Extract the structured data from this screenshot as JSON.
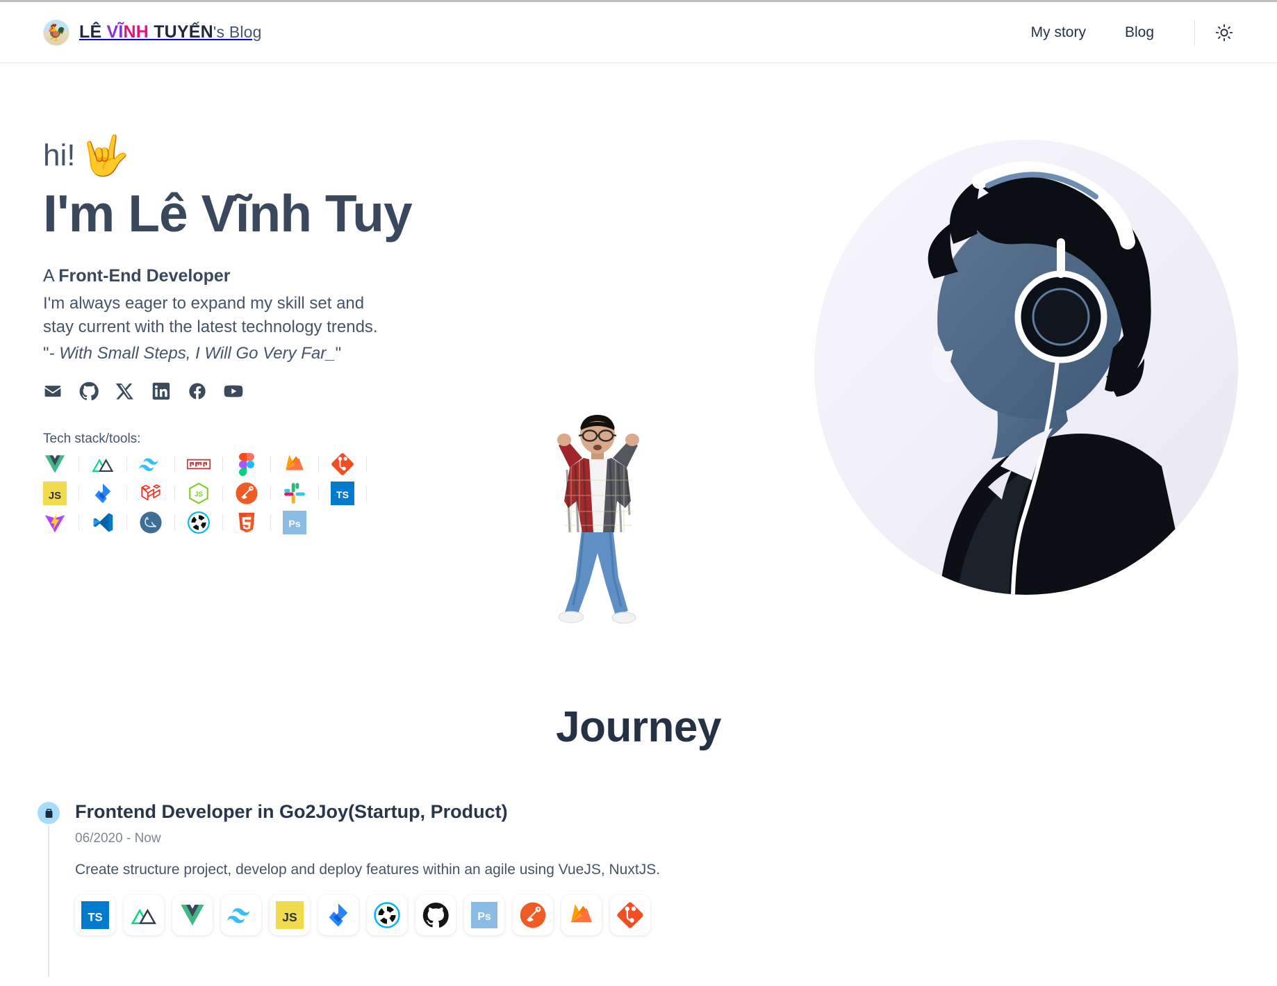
{
  "header": {
    "brand": {
      "avatar_icon": "rooster-avatar",
      "part1": "LÊ ",
      "part2": "VĨ",
      "part3": "N",
      "part4": "H",
      "part5": " TUYẾN",
      "suffix": "'s Blog"
    },
    "nav": [
      {
        "label": "My story",
        "name": "nav-my-story"
      },
      {
        "label": "Blog",
        "name": "nav-blog"
      }
    ],
    "theme_toggle_icon": "sun-icon"
  },
  "hero": {
    "greeting": "hi!",
    "greeting_emoji": "🤟",
    "name_line": "I'm Lê Vĩnh Tuy",
    "role_prefix": "A ",
    "role": "Front-End Developer",
    "blurb_line1": "I'm always eager to expand my skill set and",
    "blurb_line2": "stay current with the latest technology trends.",
    "quote_open": "\"",
    "quote_text": "- With Small Steps, I Will Go Very Far_",
    "quote_close": "\"",
    "socials": [
      {
        "name": "email-icon",
        "label": "Email"
      },
      {
        "name": "github-icon",
        "label": "GitHub"
      },
      {
        "name": "x-twitter-icon",
        "label": "X"
      },
      {
        "name": "linkedin-icon",
        "label": "LinkedIn"
      },
      {
        "name": "facebook-icon",
        "label": "Facebook"
      },
      {
        "name": "youtube-icon",
        "label": "YouTube"
      }
    ],
    "tech_label": "Tech stack/tools:",
    "tech_rows": [
      [
        {
          "name": "vue-icon",
          "label": "Vue.js"
        },
        {
          "name": "nuxt-icon",
          "label": "Nuxt"
        },
        {
          "name": "tailwind-icon",
          "label": "Tailwind CSS"
        },
        {
          "name": "npm-icon",
          "label": "npm"
        },
        {
          "name": "figma-icon",
          "label": "Figma"
        },
        {
          "name": "firebase-icon",
          "label": "Firebase"
        },
        {
          "name": "sourcetree-icon",
          "label": "Sourcetree"
        }
      ],
      [
        {
          "name": "javascript-icon",
          "label": "JavaScript"
        },
        {
          "name": "jira-icon",
          "label": "Jira"
        },
        {
          "name": "laravel-icon",
          "label": "Laravel"
        },
        {
          "name": "nodejs-icon",
          "label": "Node.js"
        },
        {
          "name": "postman-icon",
          "label": "Postman"
        },
        {
          "name": "slack-icon",
          "label": "Slack"
        },
        {
          "name": "typescript-icon",
          "label": "TypeScript"
        }
      ],
      [
        {
          "name": "vite-icon",
          "label": "Vite"
        },
        {
          "name": "vscode-icon",
          "label": "VS Code"
        },
        {
          "name": "dbeaver-icon",
          "label": "DBeaver"
        },
        {
          "name": "quasar-icon",
          "label": "Quasar"
        },
        {
          "name": "html5-icon",
          "label": "HTML5"
        },
        {
          "name": "photoshop-icon",
          "label": "Photoshop"
        }
      ]
    ],
    "dancer_alt": "dancing-avatar-character",
    "portrait_alt": "headphones-profile-illustration"
  },
  "journey": {
    "title": "Journey",
    "items": [
      {
        "icon": "briefcase-icon",
        "title": "Frontend Developer in Go2Joy(Startup, Product)",
        "date": "06/2020 - Now",
        "description": "Create structure project, develop and deploy features within an agile using VueJS, NuxtJS.",
        "badges": [
          {
            "name": "typescript-icon",
            "label": "TypeScript"
          },
          {
            "name": "nuxt-icon",
            "label": "Nuxt"
          },
          {
            "name": "vue-icon",
            "label": "Vue.js"
          },
          {
            "name": "tailwind-icon",
            "label": "Tailwind CSS"
          },
          {
            "name": "javascript-icon",
            "label": "JavaScript"
          },
          {
            "name": "jira-icon",
            "label": "Jira"
          },
          {
            "name": "quasar-icon",
            "label": "Quasar"
          },
          {
            "name": "github-icon",
            "label": "GitHub"
          },
          {
            "name": "photoshop-icon",
            "label": "Photoshop"
          },
          {
            "name": "postman-icon",
            "label": "Postman"
          },
          {
            "name": "firebase-icon",
            "label": "Firebase"
          },
          {
            "name": "sourcetree-icon",
            "label": "Sourcetree"
          }
        ]
      }
    ]
  },
  "colors": {
    "text_dark": "#39485c",
    "heading": "#253246",
    "brand_purple": "#8b2fd6",
    "brand_pink": "#e8117f",
    "bullet_blue": "#a8dcfb"
  }
}
